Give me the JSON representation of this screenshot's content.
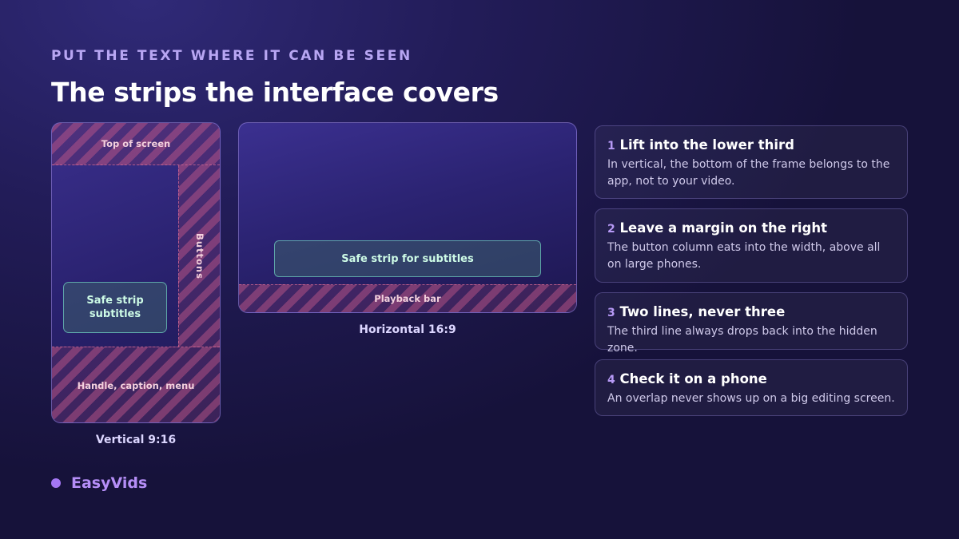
{
  "eyebrow": "PUT THE TEXT WHERE IT CAN BE SEEN",
  "title": "The strips the interface covers",
  "vertical": {
    "top_label": "Top of screen",
    "right_label": "Buttons",
    "bottom_label": "Handle, caption, menu",
    "safe_label": "Safe strip subtitles",
    "caption": "Vertical 9:16"
  },
  "horizontal": {
    "safe_label": "Safe strip for subtitles",
    "bottom_label": "Playback bar",
    "caption": "Horizontal 16:9"
  },
  "tips": [
    {
      "num": "1",
      "title": "Lift into the lower third",
      "body": "In vertical, the bottom of the frame belongs to the app, not to your video."
    },
    {
      "num": "2",
      "title": "Leave a margin on the right",
      "body": "The button column eats into the width, above all on large phones."
    },
    {
      "num": "3",
      "title": "Two lines, never three",
      "body": "The third line always drops back into the hidden zone."
    },
    {
      "num": "4",
      "title": "Check it on a phone",
      "body": "An overlap never shows up on a big editing screen."
    }
  ],
  "brand": "EasyVids",
  "colors": {
    "accent": "#a477f4",
    "hatch": "#af5082",
    "safe_border": "#6ec8be"
  }
}
